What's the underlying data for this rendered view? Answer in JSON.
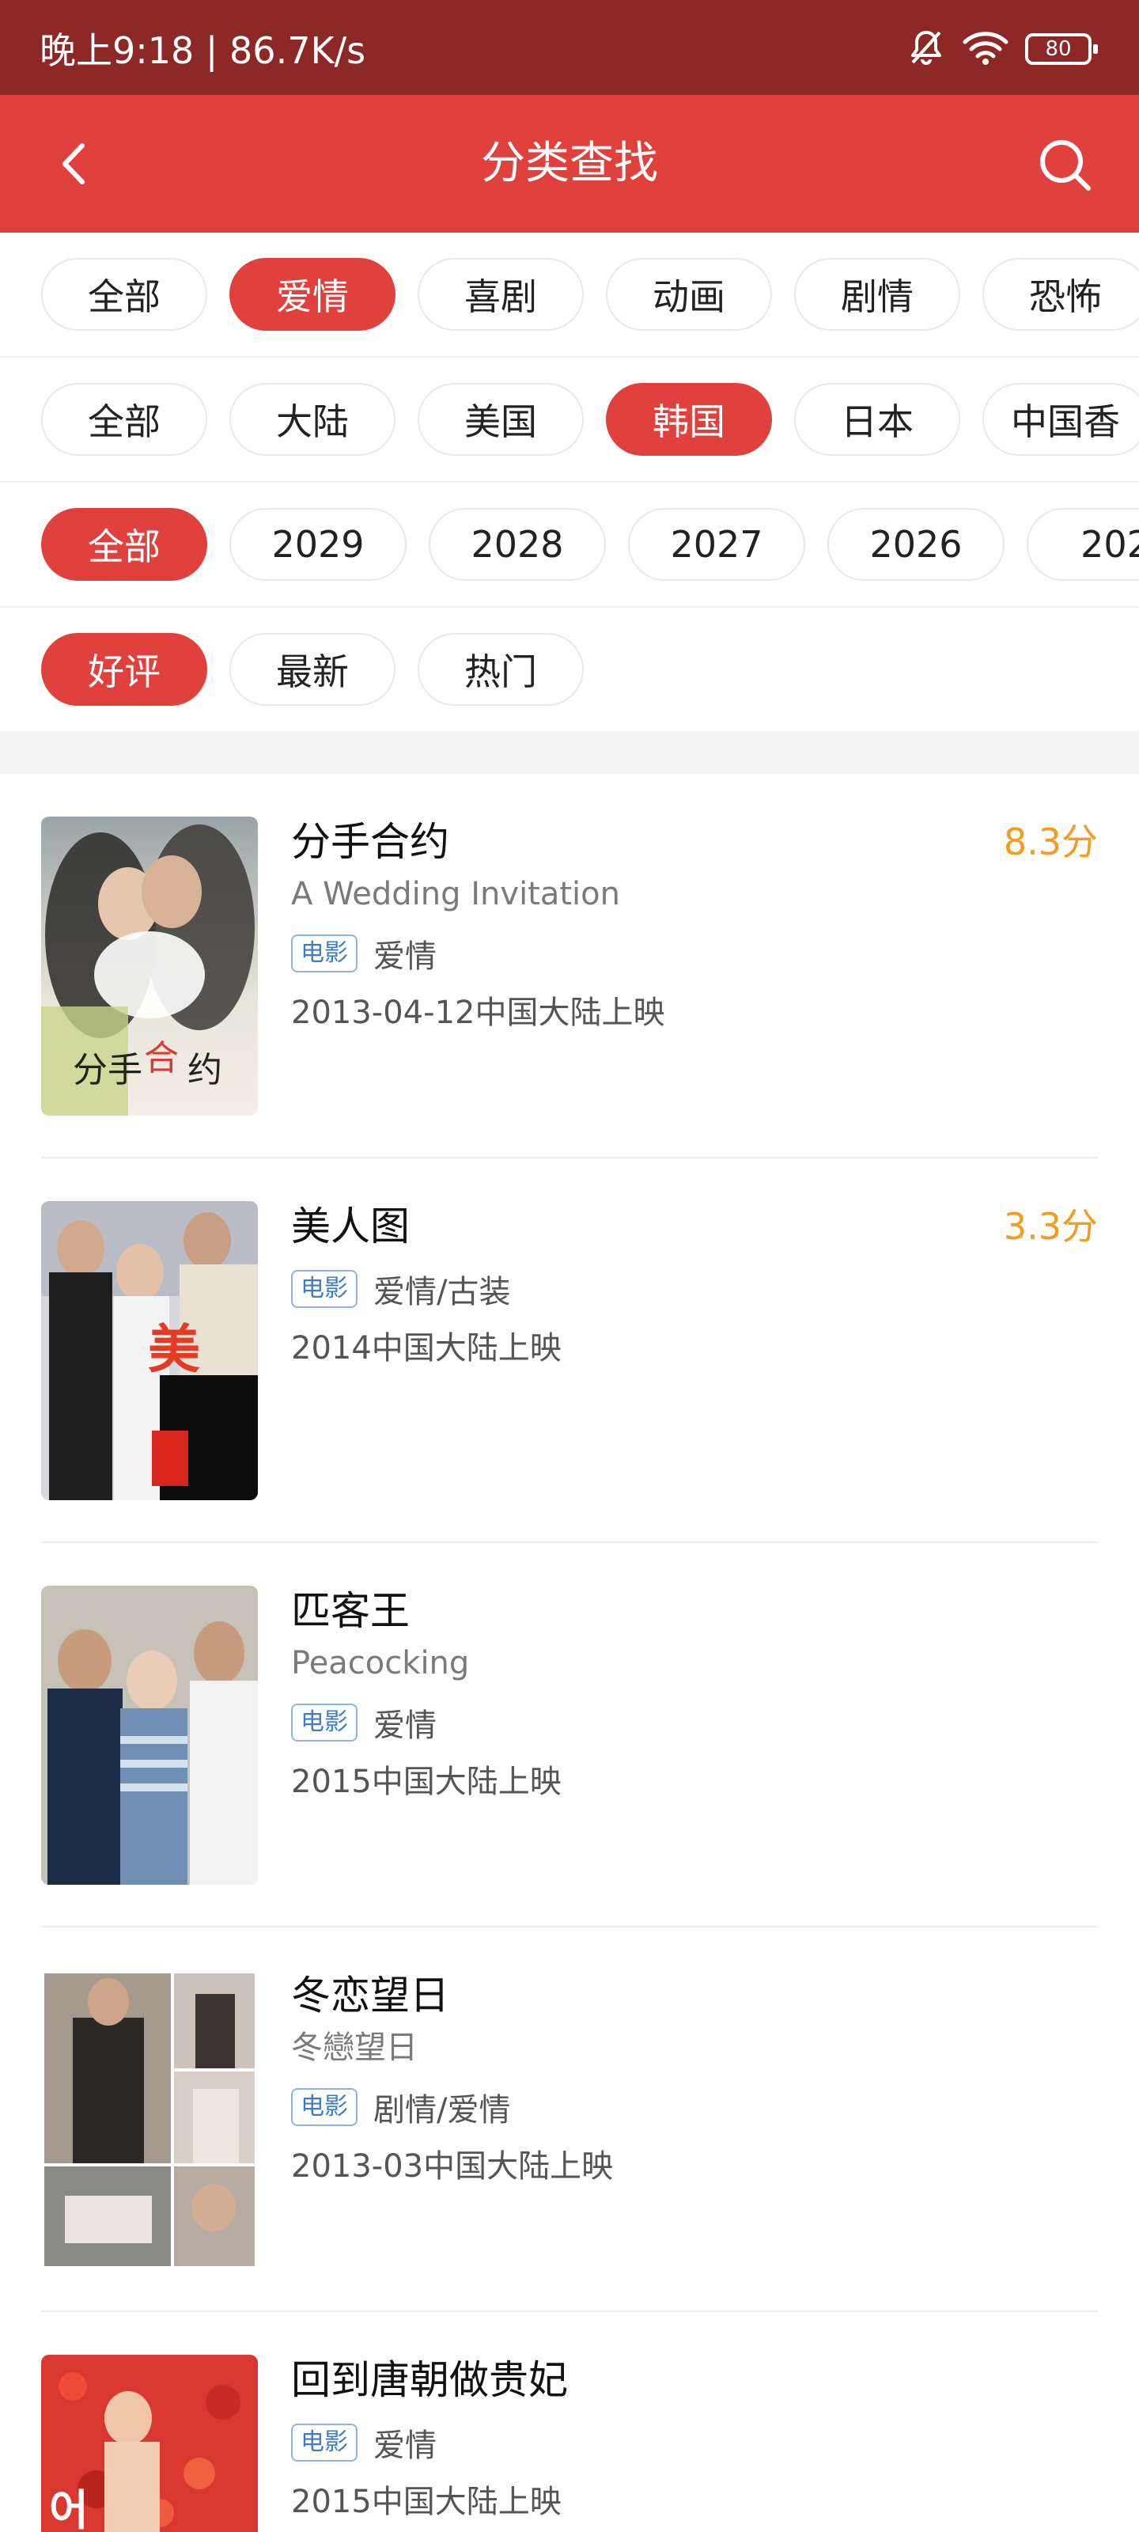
{
  "status_bar": {
    "time_speed": "晚上9:18 | 86.7K/s",
    "battery": "80",
    "icons": [
      "bell-mute-icon",
      "wifi-icon",
      "battery-icon"
    ]
  },
  "header": {
    "title": "分类查找",
    "back_icon": "chevron-left-icon",
    "search_icon": "search-icon"
  },
  "filters": {
    "genre": [
      "全部",
      "爱情",
      "喜剧",
      "动画",
      "剧情",
      "恐怖"
    ],
    "region": [
      "全部",
      "大陆",
      "美国",
      "韩国",
      "日本",
      "中国香"
    ],
    "year": [
      "全部",
      "2029",
      "2028",
      "2027",
      "2026",
      "202"
    ],
    "sort": [
      "好评",
      "最新",
      "热门"
    ]
  },
  "movies": [
    {
      "title": "分手合约",
      "alt_title": "A Wedding Invitation",
      "tag": "电影",
      "genre": "爱情",
      "release": "2013-04-12中国大陆上映",
      "score": "8.3分"
    },
    {
      "title": "美人图",
      "alt_title": "",
      "tag": "电影",
      "genre": "爱情/古装",
      "release": "2014中国大陆上映",
      "score": "3.3分"
    },
    {
      "title": "匹客王",
      "alt_title": "Peacocking",
      "tag": "电影",
      "genre": "爱情",
      "release": "2015中国大陆上映",
      "score": ""
    },
    {
      "title": "冬恋望日",
      "alt_title": "冬戀望日",
      "tag": "电影",
      "genre": "剧情/爱情",
      "release": "2013-03中国大陆上映",
      "score": ""
    },
    {
      "title": "回到唐朝做贵妃",
      "alt_title": "",
      "tag": "电影",
      "genre": "爱情",
      "release": "2015中国大陆上映",
      "score": ""
    }
  ],
  "colors": {
    "status_bar": "#8c2826",
    "header": "#e0413c",
    "accent": "#e0413c",
    "score": "#f39c1f",
    "tag": "#3d7dc8"
  }
}
